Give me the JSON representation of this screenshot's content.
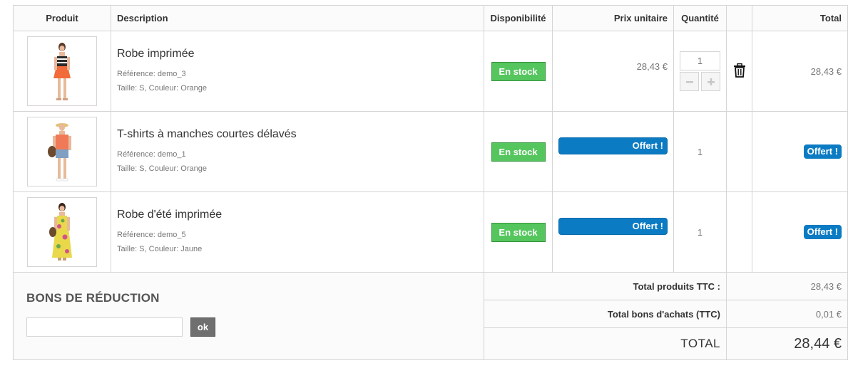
{
  "headers": {
    "produit": "Produit",
    "description": "Description",
    "disponibilite": "Disponibilité",
    "prix_unitaire": "Prix unitaire",
    "quantite": "Quantité",
    "total": "Total"
  },
  "items": [
    {
      "name": "Robe imprimée",
      "reference": "Référence: demo_3",
      "attributes": "Taille: S, Couleur: Orange",
      "availability": "En stock",
      "unit_price": "28,43 €",
      "quantity": "1",
      "total": "28,43 €"
    },
    {
      "name": "T-shirts à manches courtes délavés",
      "reference": "Référence: demo_1",
      "attributes": "Taille: S, Couleur: Orange",
      "availability": "En stock",
      "unit_price": "Offert !",
      "quantity": "1",
      "total": "Offert !"
    },
    {
      "name": "Robe d'été imprimée",
      "reference": "Référence: demo_5",
      "attributes": "Taille: S, Couleur: Jaune",
      "availability": "En stock",
      "unit_price": "Offert !",
      "quantity": "1",
      "total": "Offert !"
    }
  ],
  "voucher": {
    "title": "BONS DE RÉDUCTION",
    "input_value": "",
    "ok_label": "ok"
  },
  "summary": {
    "products_label": "Total produits TTC :",
    "products_value": "28,43 €",
    "vouchers_label": "Total bons d'achats (TTC)",
    "vouchers_value": "0,01 €",
    "grand_label": "TOTAL",
    "grand_value": "28,44 €"
  },
  "colors": {
    "in_stock": "#55c65e",
    "offert": "#0b7bc3",
    "border": "#d6d4d4"
  },
  "icons": {
    "delete": "trash-icon",
    "decrease": "minus-icon",
    "increase": "plus-icon"
  }
}
